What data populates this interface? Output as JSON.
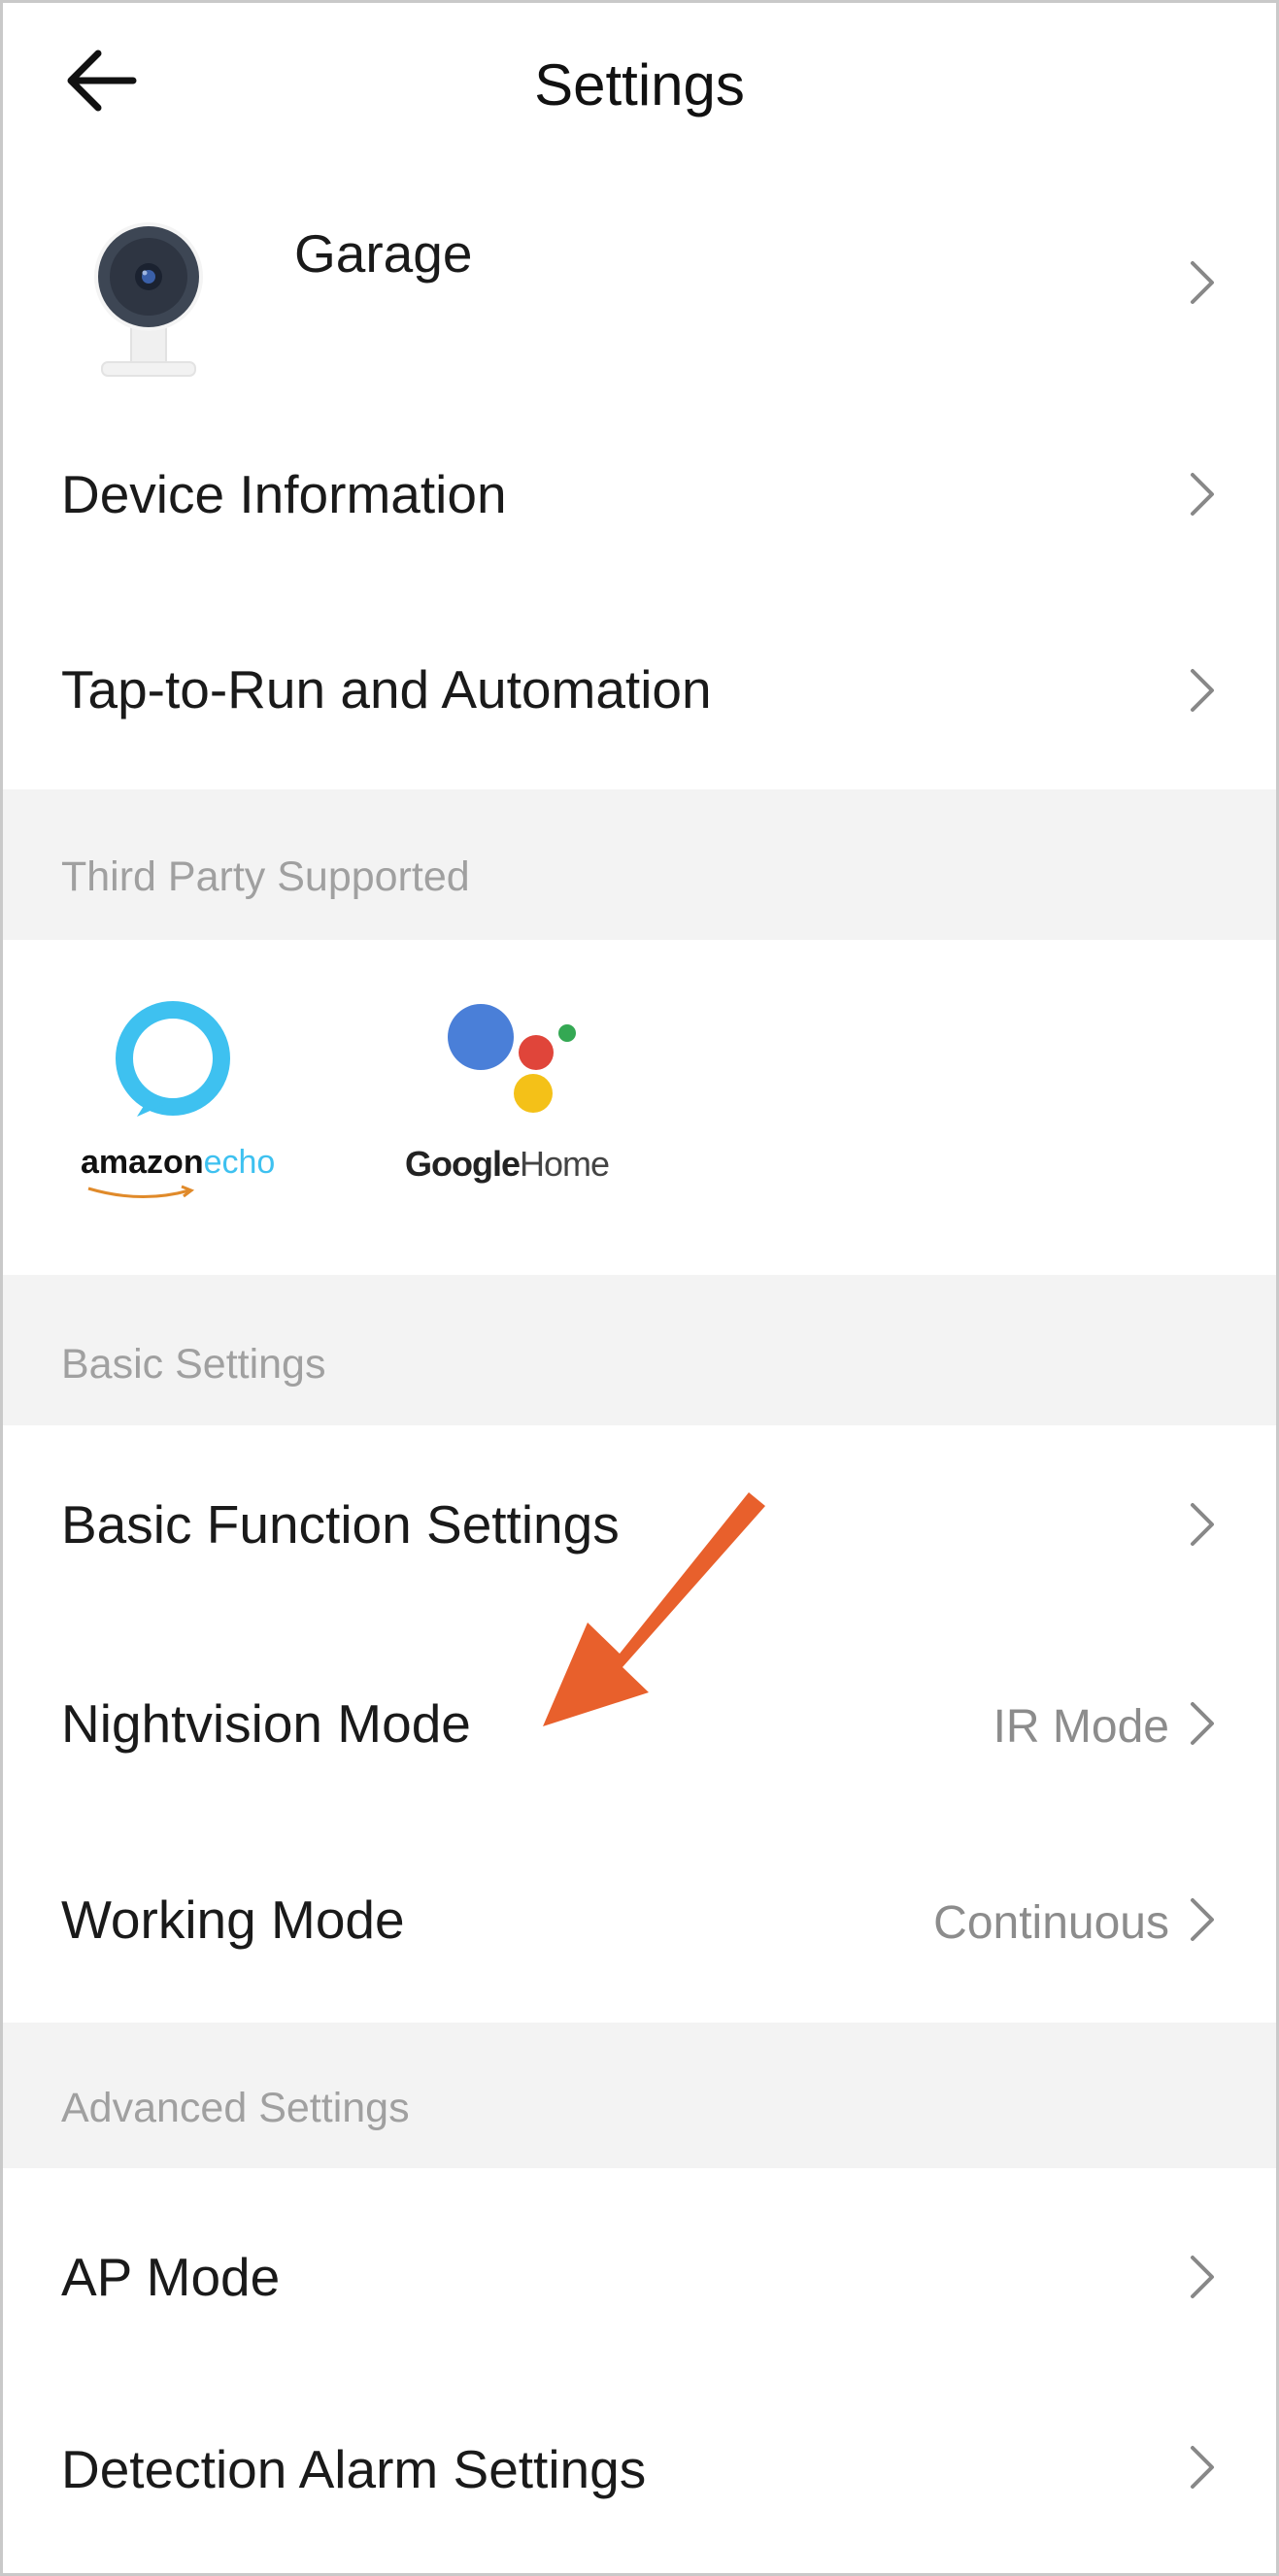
{
  "header": {
    "title": "Settings"
  },
  "device": {
    "name": "Garage"
  },
  "rows_top": [
    {
      "label": "Device Information"
    },
    {
      "label": "Tap-to-Run and Automation"
    }
  ],
  "sections": {
    "third_party": "Third Party Supported",
    "basic": "Basic Settings",
    "advanced": "Advanced Settings"
  },
  "third_party": {
    "amazon_brand": "amazon",
    "amazon_product": "echo",
    "google_brand": "Google",
    "google_product": "Home"
  },
  "basic_rows": [
    {
      "label": "Basic Function Settings",
      "value": ""
    },
    {
      "label": "Nightvision Mode",
      "value": "IR Mode"
    },
    {
      "label": "Working Mode",
      "value": "Continuous"
    }
  ],
  "advanced_rows": [
    {
      "label": "AP Mode"
    },
    {
      "label": "Detection Alarm Settings"
    }
  ],
  "colors": {
    "annotation_arrow": "#e8602c",
    "alexa_blue": "#3ec1f0",
    "google_blue": "#4a7fd8",
    "google_red": "#e0453a",
    "google_yellow": "#f4c118",
    "google_green": "#34a853",
    "section_bg": "#f3f3f3"
  },
  "icons": {
    "back": "arrow-left-icon",
    "chevron": "chevron-right-icon",
    "device": "camera-icon"
  }
}
